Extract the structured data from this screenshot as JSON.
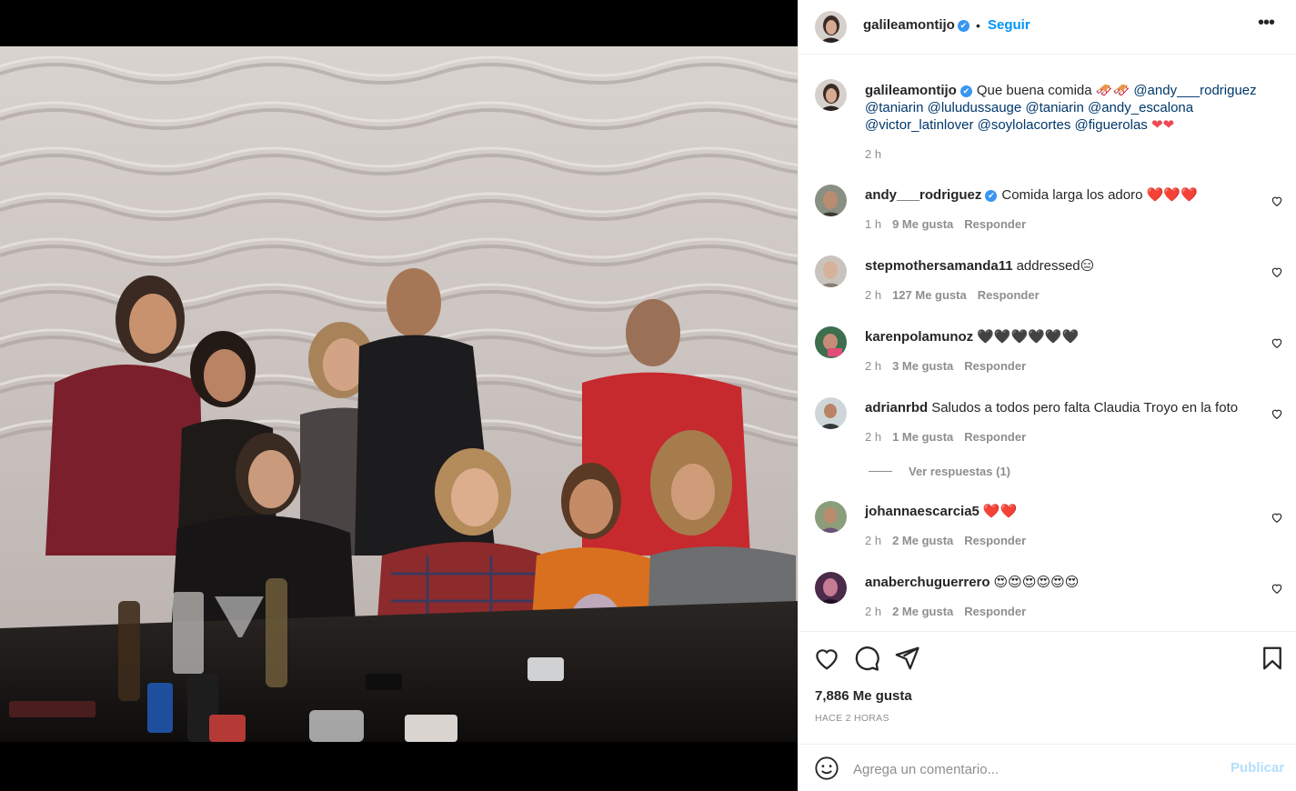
{
  "header": {
    "username": "galileamontijo",
    "verified_icon": "✔",
    "separator": "•",
    "follow_label": "Seguir",
    "more_icon": "•••"
  },
  "caption": {
    "username": "galileamontijo",
    "text": "Que buena comida",
    "text_emojis": "🛷🛷",
    "mentions_line1": "@andy___rodriguez",
    "mentions_line2": "@taniarin @luludussauge @taniarin @andy_escalona",
    "mentions_line3": "@victor_latinlover @soylolacortes @figuerolas",
    "time": "2 h"
  },
  "comments": [
    {
      "username": "andy___rodriguez",
      "verified": true,
      "text": "Comida larga los adoro",
      "emojis": "❤️❤️❤️",
      "time": "1 h",
      "likes": "9 Me gusta",
      "reply": "Responder"
    },
    {
      "username": "stepmothersamanda11",
      "verified": false,
      "text": "addressed",
      "emojis": "😑",
      "time": "2 h",
      "likes": "127 Me gusta",
      "reply": "Responder"
    },
    {
      "username": "karenpolamunoz",
      "verified": false,
      "text": "",
      "emojis": "🖤🖤🖤🖤🖤🖤",
      "time": "2 h",
      "likes": "3 Me gusta",
      "reply": "Responder"
    },
    {
      "username": "adrianrbd",
      "verified": false,
      "text": "Saludos a todos pero falta Claudia Troyo en la foto",
      "emojis": "",
      "time": "2 h",
      "likes": "1 Me gusta",
      "reply": "Responder",
      "view_replies": "Ver respuestas (1)"
    },
    {
      "username": "johannaescarcia5",
      "verified": false,
      "text": "",
      "emojis": "❤️❤️",
      "time": "2 h",
      "likes": "2 Me gusta",
      "reply": "Responder"
    },
    {
      "username": "anaberchuguerrero",
      "verified": false,
      "text": "",
      "emojis": "😍😍😍😍😍😍",
      "time": "2 h",
      "likes": "2 Me gusta",
      "reply": "Responder"
    }
  ],
  "actions": {
    "like_icon": "heart-icon",
    "comment_icon": "comment-icon",
    "share_icon": "share-icon",
    "save_icon": "bookmark-icon"
  },
  "stats": {
    "likes": "7,886 Me gusta",
    "posted": "HACE 2 HORAS"
  },
  "add_comment": {
    "placeholder": "Agrega un comentario...",
    "publish_label": "Publicar"
  },
  "colors": {
    "accent": "#0095f6",
    "publish_disabled": "#b2dffc",
    "meta_gray": "#8e8e8e",
    "mention": "#00376b",
    "verified": "#3897f0"
  }
}
